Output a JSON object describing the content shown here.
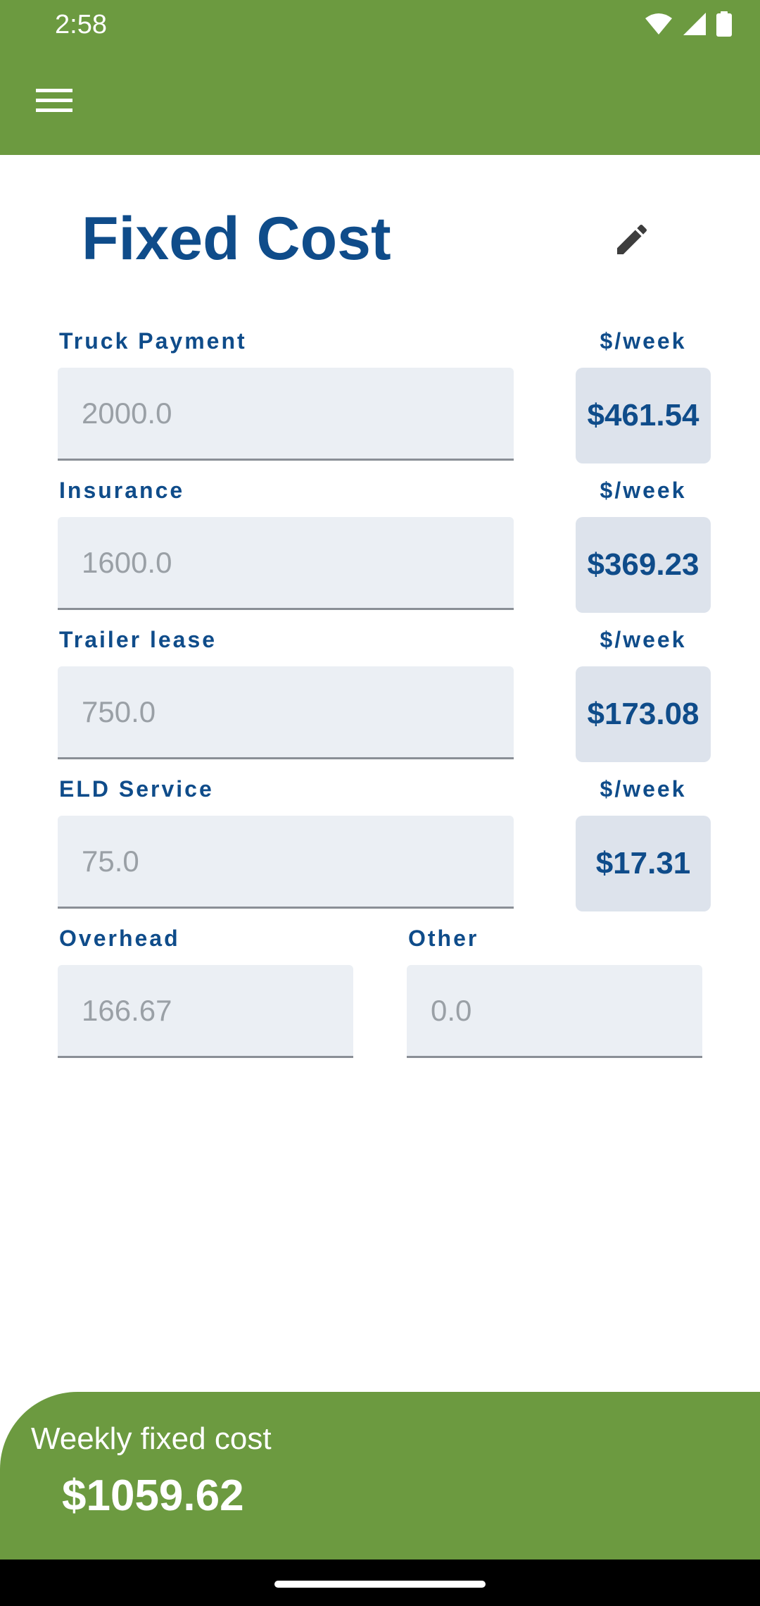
{
  "status_bar": {
    "time": "2:58"
  },
  "header": {
    "menu_icon": "menu-icon"
  },
  "page": {
    "title": "Fixed Cost",
    "edit_icon": "pencil-icon"
  },
  "fields": [
    {
      "label": "Truck Payment",
      "placeholder": "2000.0",
      "unit": "$/week",
      "weekly": "$461.54"
    },
    {
      "label": "Insurance",
      "placeholder": "1600.0",
      "unit": "$/week",
      "weekly": "$369.23"
    },
    {
      "label": "Trailer lease",
      "placeholder": "750.0",
      "unit": "$/week",
      "weekly": "$173.08"
    },
    {
      "label": "ELD Service",
      "placeholder": "75.0",
      "unit": "$/week",
      "weekly": "$17.31"
    }
  ],
  "overhead": {
    "label": "Overhead",
    "placeholder": "166.67"
  },
  "other": {
    "label": "Other",
    "placeholder": "0.0"
  },
  "footer": {
    "label": "Weekly fixed cost",
    "value": "$1059.62"
  },
  "colors": {
    "brand_green": "#6c9a40",
    "title_blue": "#0f4c8a",
    "field_bg": "#ebeff4",
    "weekly_box_bg": "#dde3ec"
  }
}
